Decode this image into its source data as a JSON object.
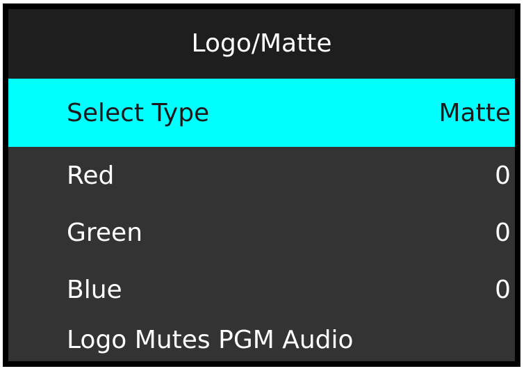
{
  "menu": {
    "title": "Logo/Matte",
    "items": [
      {
        "label": "Select Type",
        "value": "Matte",
        "selected": true
      },
      {
        "label": "Red",
        "value": "0",
        "selected": false
      },
      {
        "label": "Green",
        "value": "0",
        "selected": false
      },
      {
        "label": "Blue",
        "value": "0",
        "selected": false
      },
      {
        "label": "Logo Mutes PGM Audio",
        "value": "",
        "selected": false
      }
    ]
  },
  "colors": {
    "screen_bg": "#333333",
    "title_bg": "#1e1e1e",
    "highlight_bg": "#00ffff",
    "frame": "#000000",
    "text": "#ffffff",
    "highlight_text": "#1a1a1a"
  }
}
